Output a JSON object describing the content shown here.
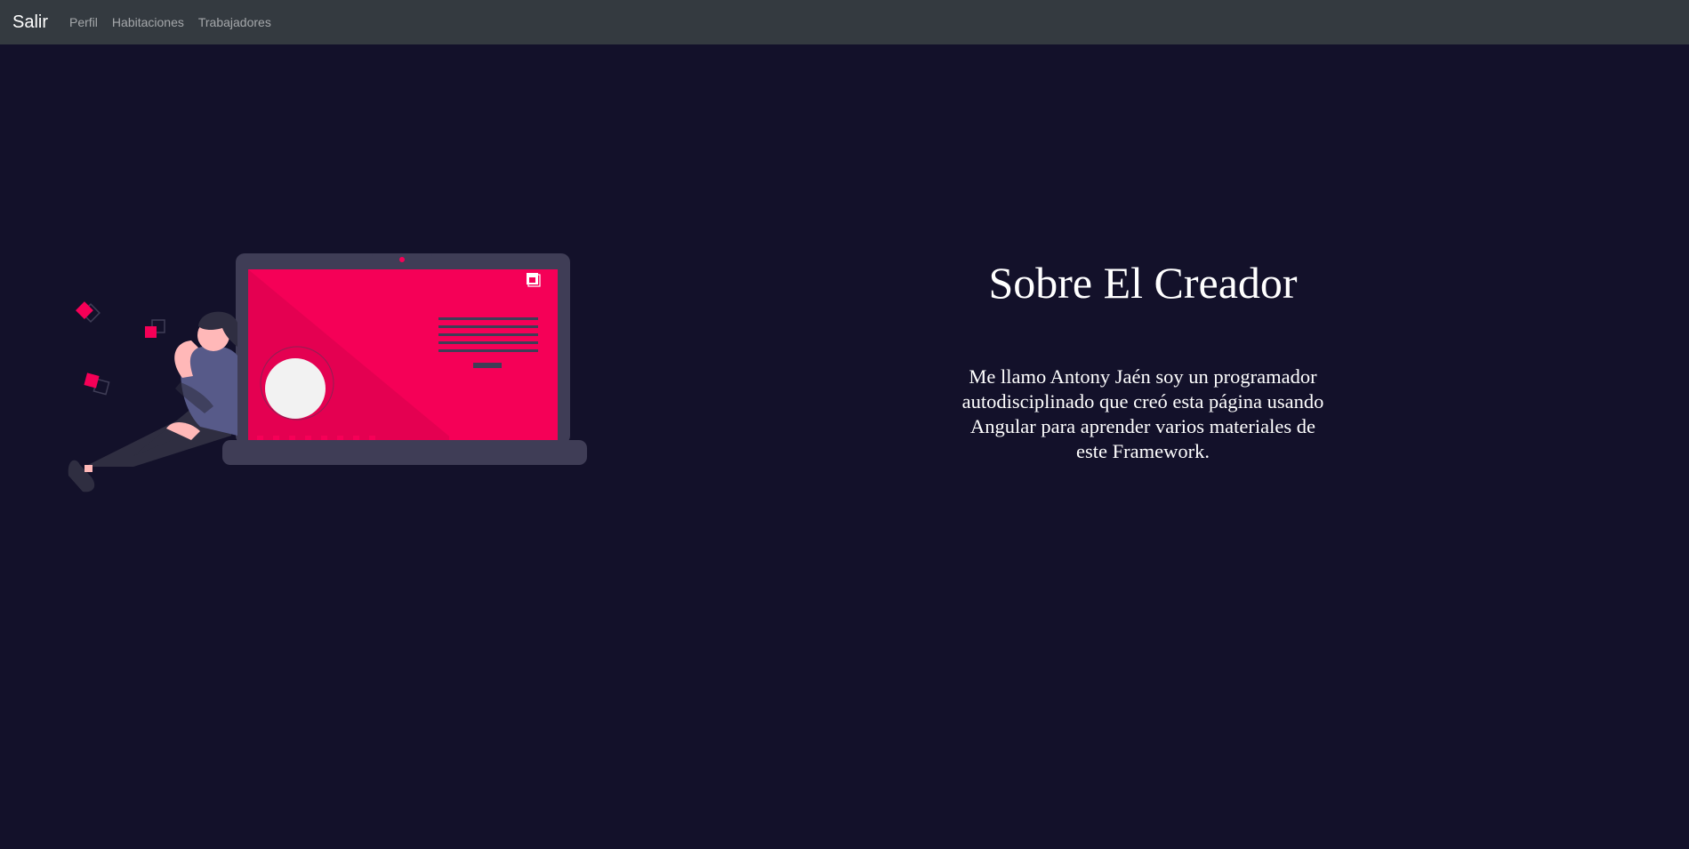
{
  "navbar": {
    "brand": "Salir",
    "links": [
      {
        "label": "Perfil"
      },
      {
        "label": "Habitaciones"
      },
      {
        "label": "Trabajadores"
      }
    ]
  },
  "about": {
    "title": "Sobre El Creador",
    "description": "Me llamo Antony Jaén soy un programador autodisciplinado que creó esta página usando Angular para aprender varios materiales de este Framework."
  },
  "illustration": {
    "subject": "person-leaning-on-laptop",
    "colors": {
      "accent": "#f50057",
      "laptop_body": "#3f3d56",
      "background": "#13112a",
      "navbar": "#343a40"
    }
  }
}
